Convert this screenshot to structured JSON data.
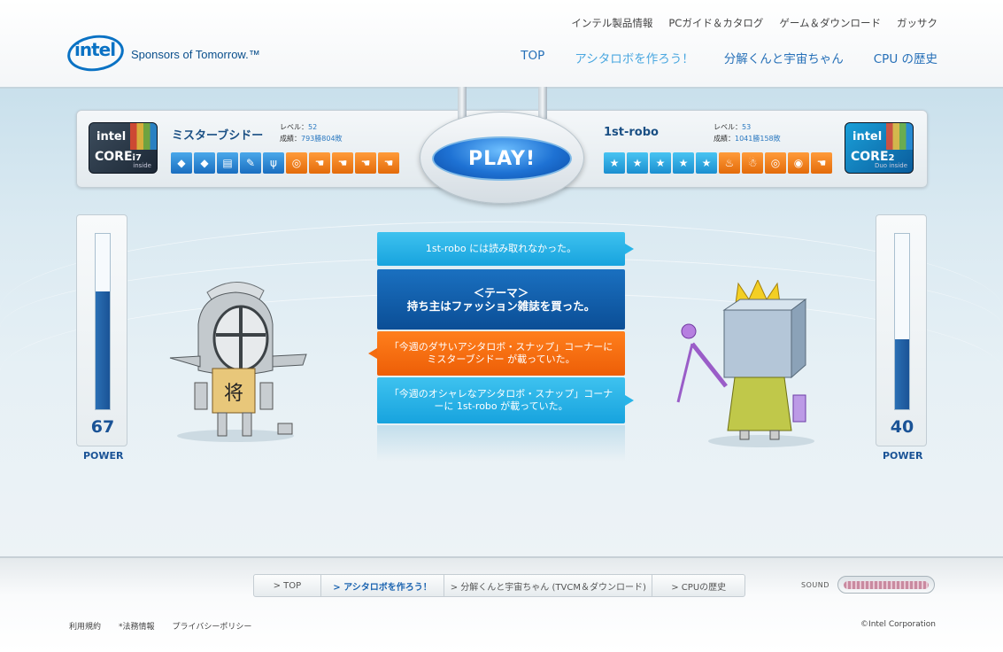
{
  "header": {
    "logo_word": "intel",
    "tagline": "Sponsors of Tomorrow.™",
    "top_links": [
      "インテル製品情報",
      "PCガイド＆カタログ",
      "ゲーム＆ダウンロード",
      "ガッサク"
    ],
    "main_nav": [
      "TOP",
      "アシタロボを作ろう！",
      "分解くんと宇宙ちゃん",
      "CPU の歴史"
    ],
    "main_nav_active_index": 1
  },
  "player_left": {
    "chip": {
      "intel": "intel",
      "core": "CORE",
      "model": "i7",
      "sub": "inside"
    },
    "name": "ミスターブシドー",
    "level_label": "レベル：",
    "level": "52",
    "record_label": "成績：",
    "record": "793勝804敗",
    "badges": [
      {
        "icon": "diamond-icon",
        "color": "blue"
      },
      {
        "icon": "diamond-icon",
        "color": "blue"
      },
      {
        "icon": "document-icon",
        "color": "blue"
      },
      {
        "icon": "paint-icon",
        "color": "blue"
      },
      {
        "icon": "fork-knife-icon",
        "color": "blue"
      },
      {
        "icon": "magnifier-icon",
        "color": "orange"
      },
      {
        "icon": "hand-icon",
        "color": "orange"
      },
      {
        "icon": "hand-icon",
        "color": "orange"
      },
      {
        "icon": "hand-icon",
        "color": "orange"
      },
      {
        "icon": "hand-icon",
        "color": "orange"
      }
    ],
    "power": 67,
    "power_label": "POWER"
  },
  "player_right": {
    "chip": {
      "intel": "intel",
      "core": "CORE",
      "model": "2",
      "sub": "Duo inside"
    },
    "name": "1st-robo",
    "level_label": "レベル：",
    "level": "53",
    "record_label": "成績：",
    "record": "1041勝158敗",
    "badges": [
      {
        "icon": "star-icon",
        "color": "cyan"
      },
      {
        "icon": "star-icon",
        "color": "cyan"
      },
      {
        "icon": "star-icon",
        "color": "cyan"
      },
      {
        "icon": "star-icon",
        "color": "cyan"
      },
      {
        "icon": "star-icon",
        "color": "cyan"
      },
      {
        "icon": "faucet-icon",
        "color": "orange"
      },
      {
        "icon": "penguin-icon",
        "color": "orange"
      },
      {
        "icon": "magnifier-icon",
        "color": "orange"
      },
      {
        "icon": "globe-icon",
        "color": "orange"
      },
      {
        "icon": "hand-icon",
        "color": "orange"
      }
    ],
    "power": 40,
    "power_label": "POWER"
  },
  "play_button": "PLAY!",
  "messages": [
    {
      "text": "1st-robo には読み取れなかった。",
      "style": "cyan",
      "arrow": "right"
    },
    {
      "text": "＜テーマ＞\n持ち主はファッション雑誌を買った。",
      "style": "dark",
      "arrow": "none"
    },
    {
      "text": "「今週のダサいアシタロボ・スナップ」コーナーに ミスターブシドー が載っていた。",
      "style": "orange",
      "arrow": "left"
    },
    {
      "text": "「今週のオシャレなアシタロボ・スナップ」コーナーに 1st-robo が載っていた。",
      "style": "cyan",
      "arrow": "right"
    }
  ],
  "footer": {
    "nav": [
      "> TOP",
      "> アシタロボを作ろう！",
      "> 分解くんと宇宙ちゃん (TVCM＆ダウンロード)",
      "> CPUの歴史"
    ],
    "nav_active_index": 1,
    "sound_label": "SOUND",
    "links": [
      "利用規約",
      "*法務情報",
      "プライバシーポリシー"
    ],
    "copyright": "©Intel Corporation"
  },
  "colors": {
    "accent": "#1a63b0",
    "orange": "#f46c10",
    "cyan": "#28b4e8"
  }
}
